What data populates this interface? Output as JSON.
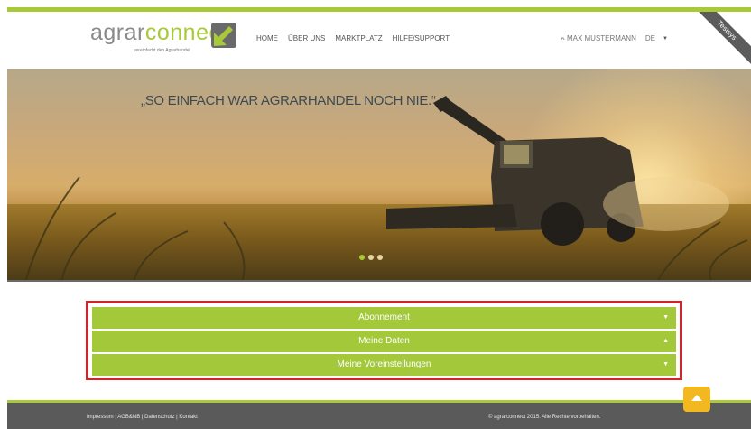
{
  "brand": {
    "name_part1": "agrar",
    "name_part2": "connect",
    "tagline": "vereinfacht den Agrarhandel",
    "accent": "#a8c93a"
  },
  "nav": {
    "items": [
      {
        "label": "HOME"
      },
      {
        "label": "ÜBER UNS"
      },
      {
        "label": "MARKTPLATZ"
      },
      {
        "label": "HILFE/SUPPORT"
      }
    ]
  },
  "user": {
    "small_label": "ᵗᴾᴸ",
    "name": "MAX MUSTERMANN",
    "language": "DE",
    "caret_icon": "chevron-down-icon"
  },
  "ribbon": {
    "label": "Testsys"
  },
  "hero": {
    "quote": "„SO EINFACH WAR AGRARHANDEL NOCH NIE.“",
    "slides_total": 3,
    "active_slide": 1
  },
  "accordion": {
    "highlight_color": "#d0232a",
    "items": [
      {
        "label": "Abonnement",
        "caret": "▼"
      },
      {
        "label": "Meine Daten",
        "caret": "▲"
      },
      {
        "label": "Meine Voreinstellungen",
        "caret": "▼"
      }
    ]
  },
  "footer": {
    "links": [
      "Impressum",
      "AGB&NB",
      "Datenschutz",
      "Kontakt"
    ],
    "separator": " | ",
    "copyright": "© agrarconnect 2015. Alle Rechte vorbehalten.",
    "to_top_icon": "arrow-up-icon"
  }
}
